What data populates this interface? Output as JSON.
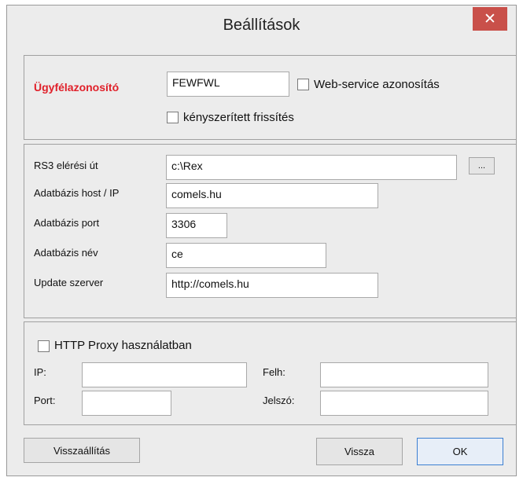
{
  "window": {
    "title": "Beállítások",
    "close_symbol": "✕"
  },
  "customer": {
    "id_label": "Ügyfélazonosító",
    "id_value": "FEWFWL",
    "webservice_auth_label": "Web-service azonosítás",
    "webservice_auth_checked": false,
    "forced_refresh_label": "kényszerített frissítés",
    "forced_refresh_checked": false
  },
  "database": {
    "rs3_path_label": "RS3 elérési út",
    "rs3_path_value": "c:\\Rex",
    "browse_label": "...",
    "host_label": "Adatbázis host / IP",
    "host_value": "comels.hu",
    "port_label": "Adatbázis port",
    "port_value": "3306",
    "name_label": "Adatbázis név",
    "name_value": "ce",
    "update_server_label": "Update szerver",
    "update_server_value": "http://comels.hu"
  },
  "proxy": {
    "enabled_label": "HTTP Proxy használatban",
    "enabled_checked": false,
    "ip_label": "IP:",
    "ip_value": "",
    "port_label": "Port:",
    "port_value": "",
    "user_label": "Felh:",
    "user_value": "",
    "password_label": "Jelszó:",
    "password_value": ""
  },
  "buttons": {
    "reset_label": "Visszaállítás",
    "back_label": "Vissza",
    "ok_label": "OK"
  }
}
